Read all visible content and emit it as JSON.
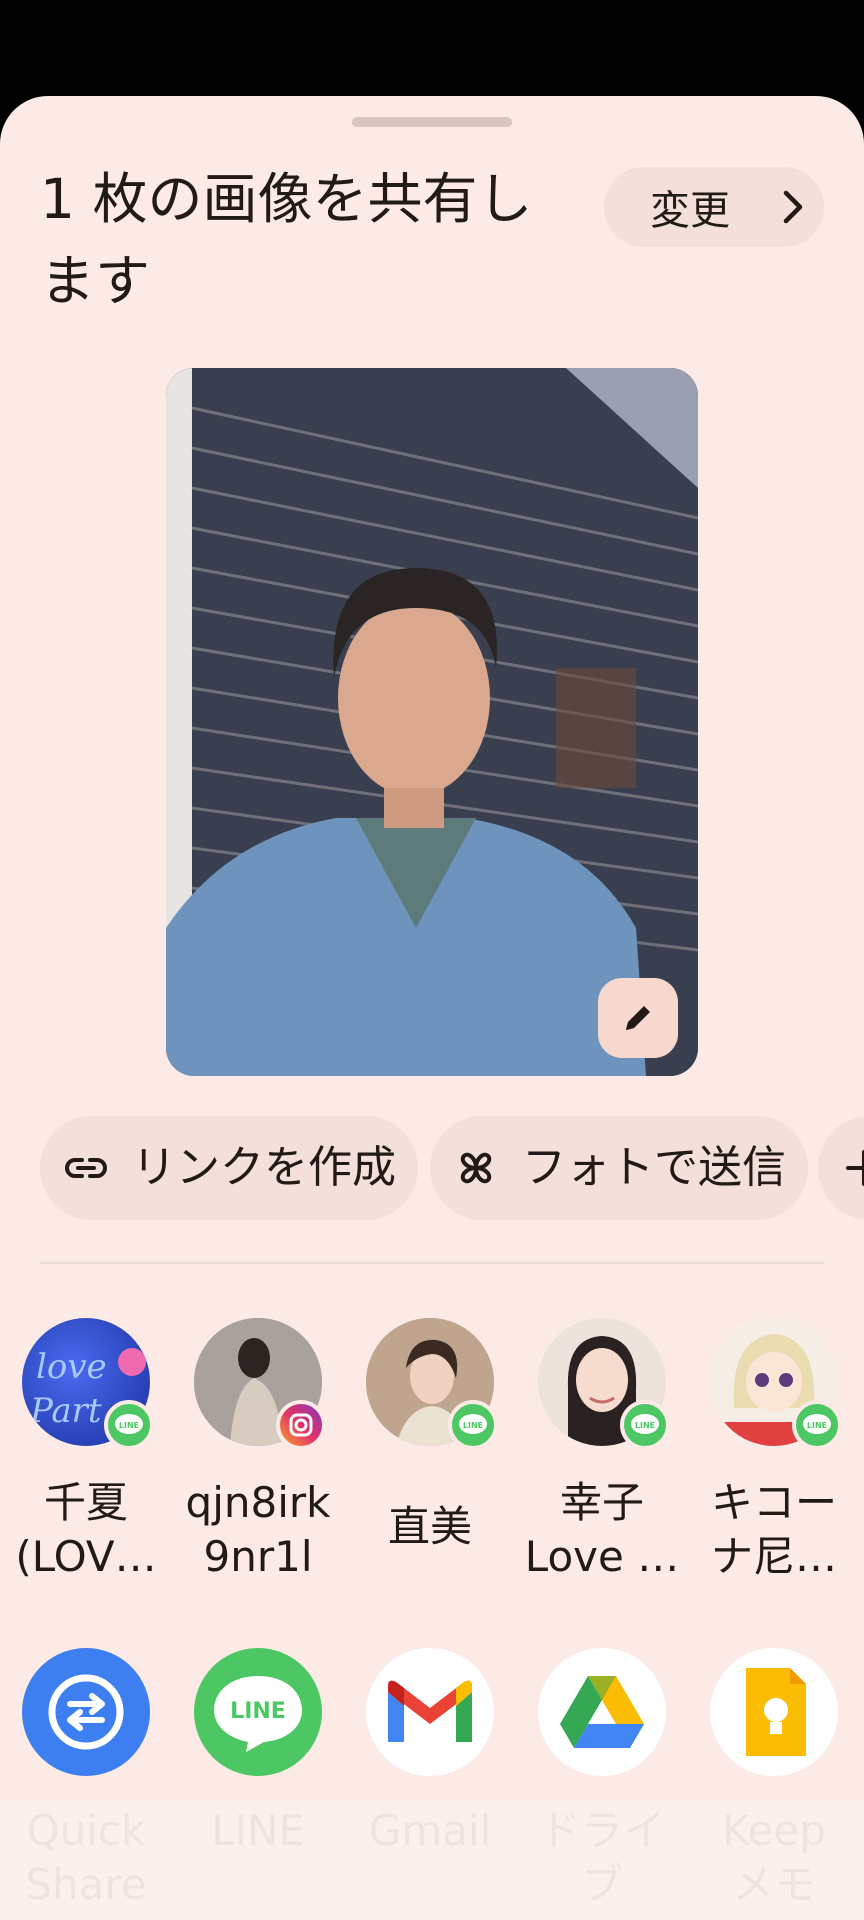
{
  "sheet": {
    "title": "1 枚の画像を共有します",
    "change_label": "変更"
  },
  "actions": [
    {
      "label": "リンクを作成",
      "icon": "link-icon"
    },
    {
      "label": "フォトで送信",
      "icon": "pinwheel-icon"
    }
  ],
  "direct_targets": [
    {
      "name": "千夏\n(LOV…",
      "app": "LINE"
    },
    {
      "name": "qjn8irk\n9nr1l",
      "app": "Instagram"
    },
    {
      "name": "直美",
      "app": "LINE"
    },
    {
      "name": "幸子\nLove …",
      "app": "LINE"
    },
    {
      "name": "キコー\nナ尼…",
      "app": "LINE"
    }
  ],
  "apps": [
    {
      "name": "Quick\nShare",
      "icon": "quick-share-icon"
    },
    {
      "name": "LINE",
      "icon": "line-icon"
    },
    {
      "name": "Gmail",
      "icon": "gmail-icon"
    },
    {
      "name": "ドライ\nブ",
      "icon": "drive-icon"
    },
    {
      "name": "Keep\nメモ",
      "icon": "keep-icon"
    }
  ],
  "colors": {
    "sheet_bg": "#fbeae5",
    "chip_bg": "#f3e0da",
    "line_green": "#4cc764",
    "quick_share_blue": "#3d7ff0"
  }
}
